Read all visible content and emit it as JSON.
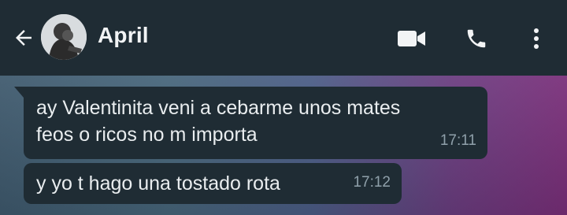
{
  "header": {
    "contact_name": "April",
    "background_color": "#1f2c34",
    "icons": {
      "back": "arrow-left-icon",
      "video": "video-camera-icon",
      "call": "phone-icon",
      "menu": "kebab-menu-icon"
    }
  },
  "messages": [
    {
      "text": "ay Valentinita veni a cebarme unos mates\nfeos o ricos no m importa",
      "time": "17:11",
      "direction": "incoming"
    },
    {
      "text": "y yo t hago una tostado rota",
      "time": "17:12",
      "direction": "incoming"
    }
  ],
  "colors": {
    "bubble": "#1f2c34",
    "message_text": "#e9edef",
    "timestamp": "#8fa0aa"
  }
}
